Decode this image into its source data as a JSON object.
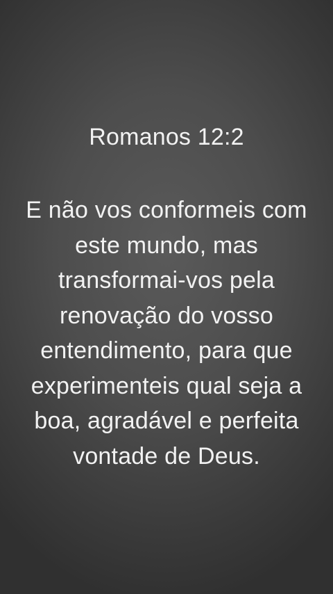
{
  "verse": {
    "reference": "Romanos 12:2",
    "lines": [
      "E não vos conformeis com",
      "este mundo, mas",
      "transformai-vos pela",
      "renovação do vosso",
      "entendimento, para que",
      "experimenteis qual seja a",
      "boa, agradável e perfeita",
      "vontade de Deus."
    ]
  }
}
